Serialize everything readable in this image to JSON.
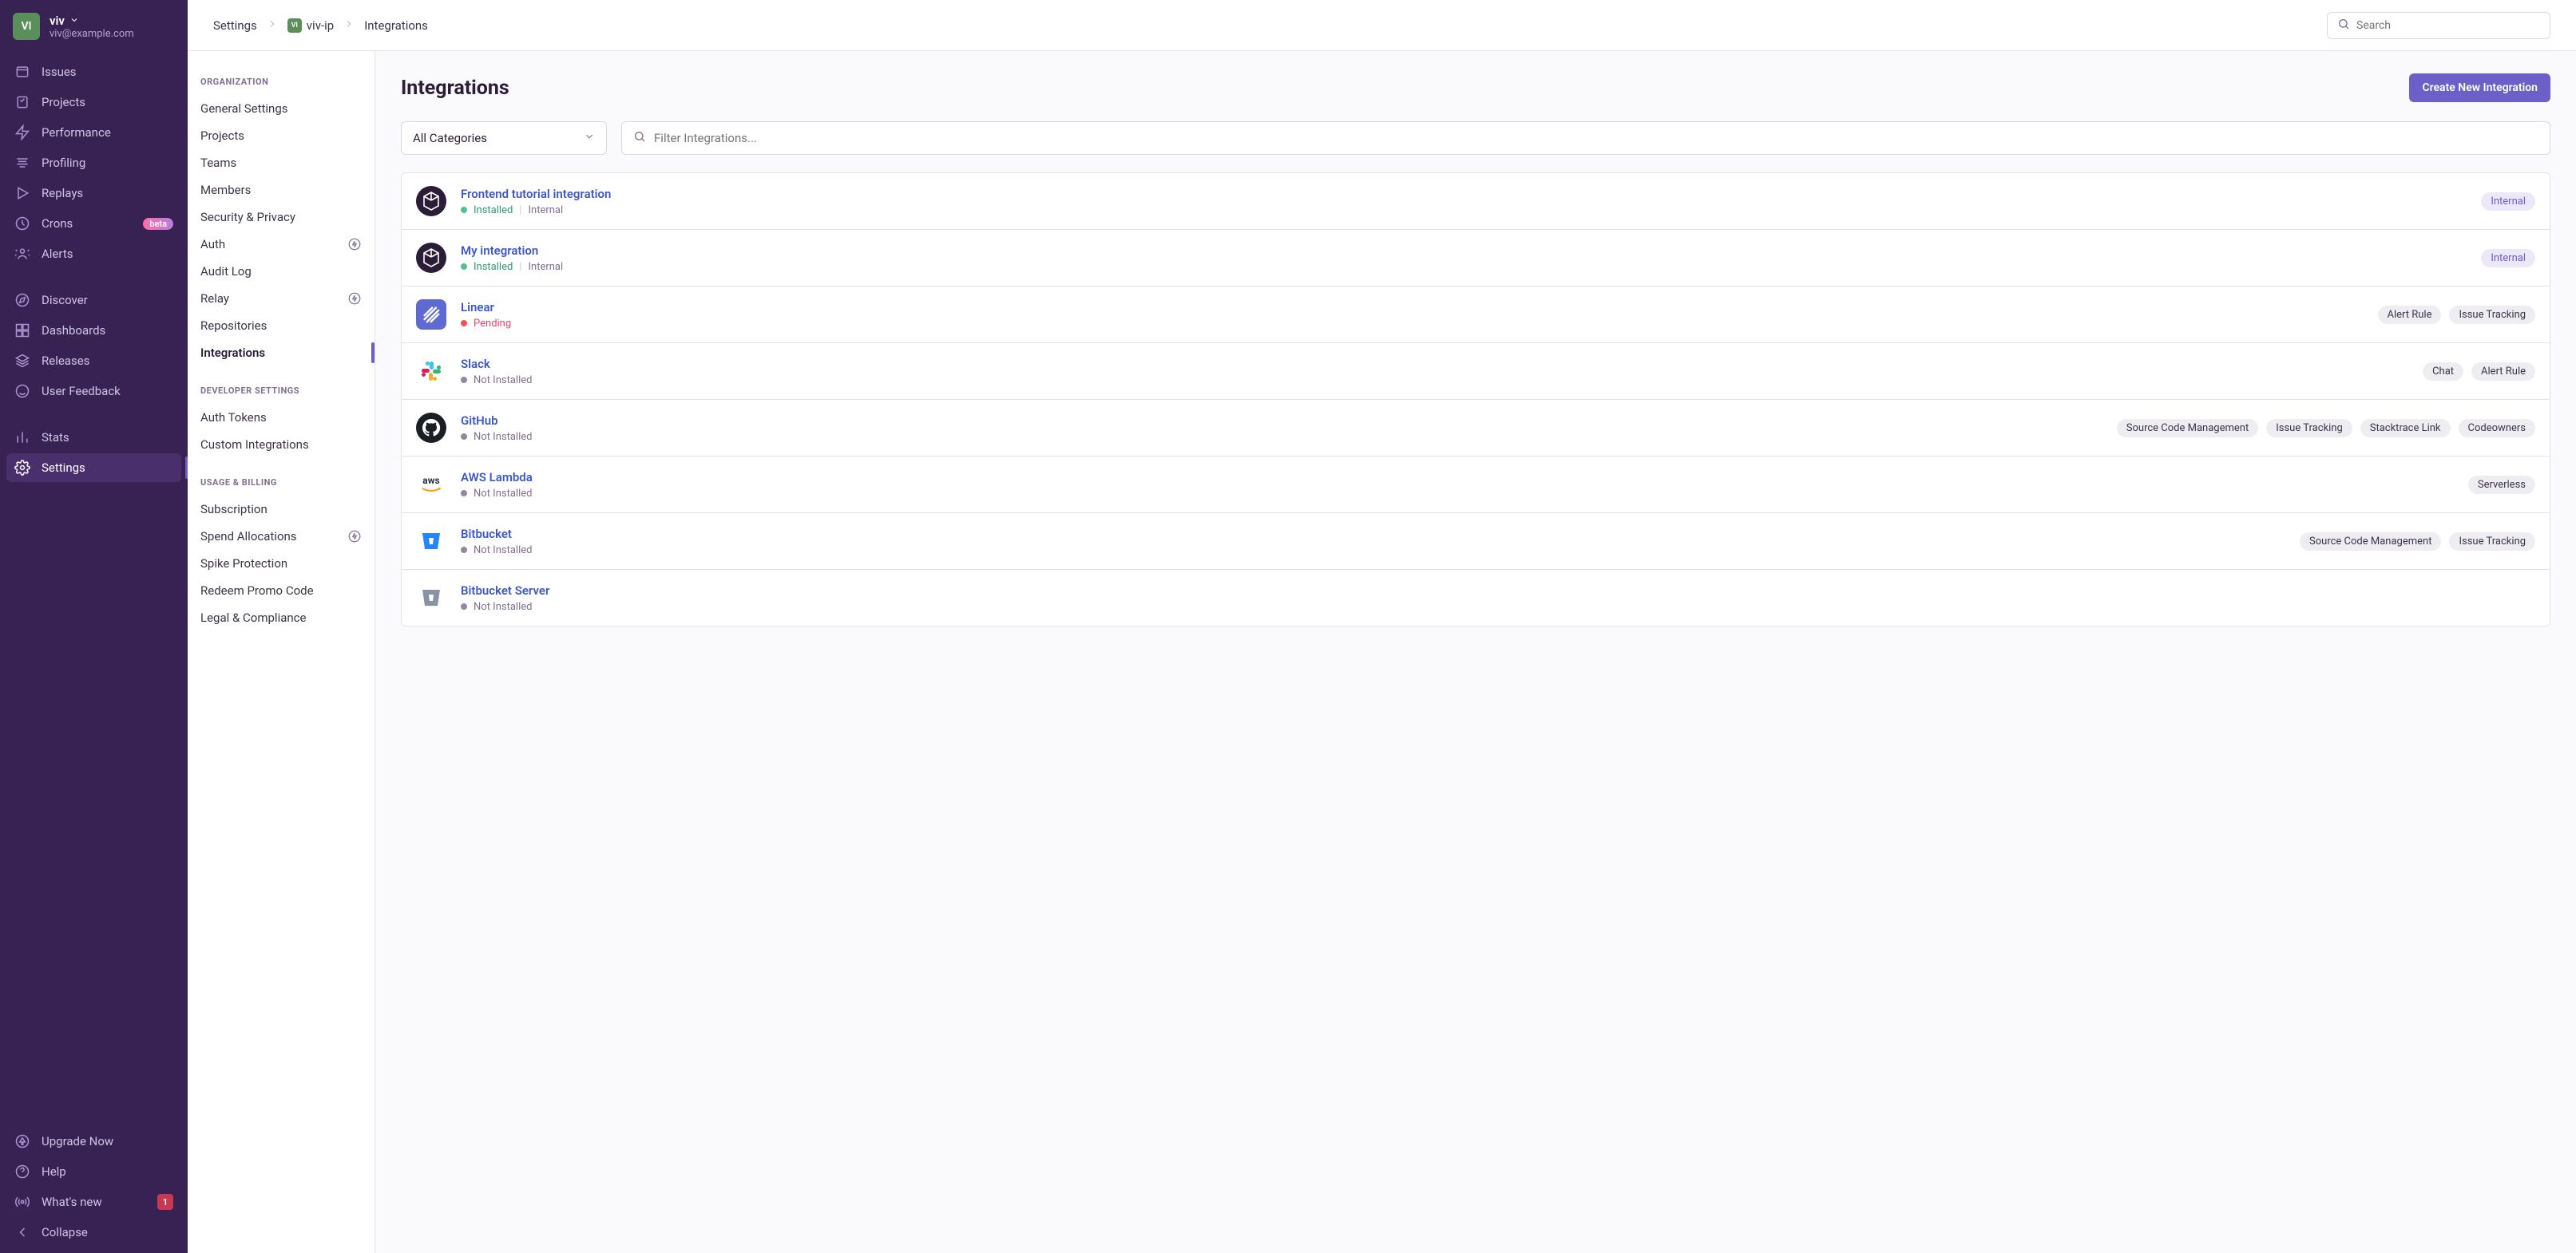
{
  "user": {
    "avatar_initials": "VI",
    "name": "viv",
    "email": "viv@example.com"
  },
  "nav_primary": {
    "items": [
      {
        "icon": "issues",
        "label": "Issues"
      },
      {
        "icon": "projects",
        "label": "Projects"
      },
      {
        "icon": "performance",
        "label": "Performance"
      },
      {
        "icon": "profiling",
        "label": "Profiling"
      },
      {
        "icon": "replays",
        "label": "Replays"
      },
      {
        "icon": "crons",
        "label": "Crons",
        "badge": "beta"
      },
      {
        "icon": "alerts",
        "label": "Alerts"
      }
    ],
    "items2": [
      {
        "icon": "discover",
        "label": "Discover"
      },
      {
        "icon": "dashboards",
        "label": "Dashboards"
      },
      {
        "icon": "releases",
        "label": "Releases"
      },
      {
        "icon": "user-feedback",
        "label": "User Feedback"
      }
    ],
    "items3": [
      {
        "icon": "stats",
        "label": "Stats"
      },
      {
        "icon": "settings",
        "label": "Settings",
        "active": true
      }
    ]
  },
  "nav_footer": {
    "items": [
      {
        "icon": "upgrade",
        "label": "Upgrade Now"
      },
      {
        "icon": "help",
        "label": "Help"
      },
      {
        "icon": "whatsnew",
        "label": "What's new",
        "count": "1"
      },
      {
        "icon": "collapse",
        "label": "Collapse"
      }
    ]
  },
  "settings_nav": {
    "sections": [
      {
        "title": "ORGANIZATION",
        "items": [
          {
            "label": "General Settings"
          },
          {
            "label": "Projects"
          },
          {
            "label": "Teams"
          },
          {
            "label": "Members"
          },
          {
            "label": "Security & Privacy"
          },
          {
            "label": "Auth",
            "trailing": true
          },
          {
            "label": "Audit Log"
          },
          {
            "label": "Relay",
            "trailing": true
          },
          {
            "label": "Repositories"
          },
          {
            "label": "Integrations",
            "active": true
          }
        ]
      },
      {
        "title": "DEVELOPER SETTINGS",
        "items": [
          {
            "label": "Auth Tokens"
          },
          {
            "label": "Custom Integrations"
          }
        ]
      },
      {
        "title": "USAGE & BILLING",
        "items": [
          {
            "label": "Subscription"
          },
          {
            "label": "Spend Allocations",
            "trailing": true
          },
          {
            "label": "Spike Protection"
          },
          {
            "label": "Redeem Promo Code"
          },
          {
            "label": "Legal & Compliance"
          }
        ]
      }
    ]
  },
  "topbar": {
    "breadcrumb": {
      "root": "Settings",
      "proj_initials": "VI",
      "project": "viv-ip",
      "page": "Integrations"
    },
    "search_placeholder": "Search"
  },
  "page": {
    "title": "Integrations",
    "create_button": "Create New Integration",
    "category_select": "All Categories",
    "filter_placeholder": "Filter Integrations..."
  },
  "integrations": [
    {
      "logo": "generic-cube",
      "name": "Frontend tutorial integration",
      "status": "installed",
      "status_label": "Installed",
      "meta": "Internal",
      "tags": [
        {
          "label": "Internal",
          "internal": true
        }
      ]
    },
    {
      "logo": "generic-cube",
      "name": "My integration",
      "status": "installed",
      "status_label": "Installed",
      "meta": "Internal",
      "tags": [
        {
          "label": "Internal",
          "internal": true
        }
      ]
    },
    {
      "logo": "linear",
      "name": "Linear",
      "status": "pending",
      "status_label": "Pending",
      "tags": [
        {
          "label": "Alert Rule"
        },
        {
          "label": "Issue Tracking"
        }
      ]
    },
    {
      "logo": "slack",
      "name": "Slack",
      "status": "notinstalled",
      "status_label": "Not Installed",
      "tags": [
        {
          "label": "Chat"
        },
        {
          "label": "Alert Rule"
        }
      ]
    },
    {
      "logo": "github",
      "name": "GitHub",
      "status": "notinstalled",
      "status_label": "Not Installed",
      "tags": [
        {
          "label": "Source Code Management"
        },
        {
          "label": "Issue Tracking"
        },
        {
          "label": "Stacktrace Link"
        },
        {
          "label": "Codeowners"
        }
      ]
    },
    {
      "logo": "aws",
      "name": "AWS Lambda",
      "status": "notinstalled",
      "status_label": "Not Installed",
      "tags": [
        {
          "label": "Serverless"
        }
      ]
    },
    {
      "logo": "bitbucket",
      "name": "Bitbucket",
      "status": "notinstalled",
      "status_label": "Not Installed",
      "tags": [
        {
          "label": "Source Code Management"
        },
        {
          "label": "Issue Tracking"
        }
      ]
    },
    {
      "logo": "bitbucket-gray",
      "name": "Bitbucket Server",
      "status": "notinstalled",
      "status_label": "Not Installed",
      "tags": []
    }
  ]
}
